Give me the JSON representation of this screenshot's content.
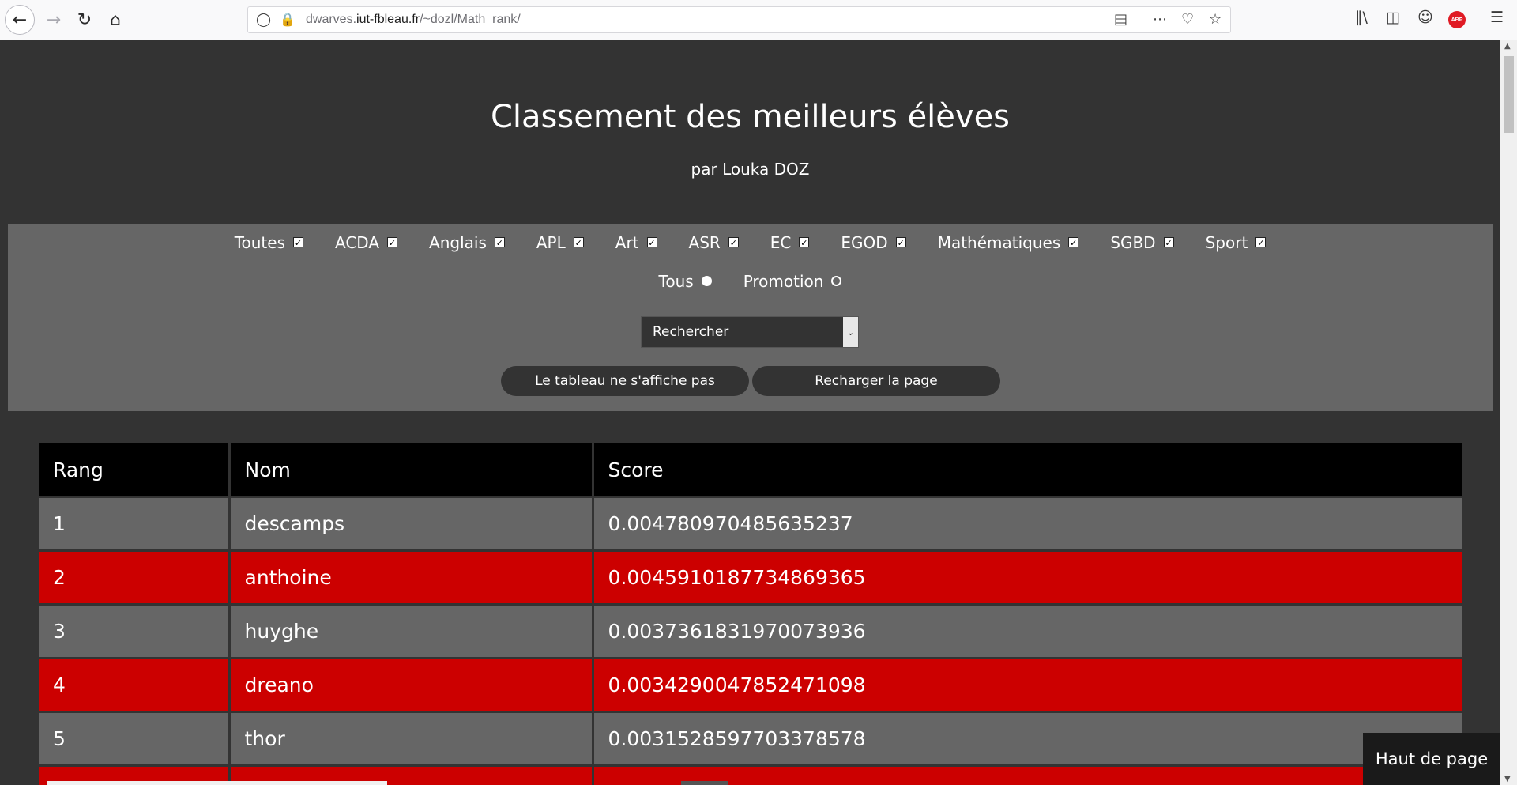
{
  "browser": {
    "url_host_prefix": "dwarves.",
    "url_host_domain": "iut-fbleau.fr",
    "url_path": "/~dozl/Math_rank/",
    "icons": [
      "back-arrow-icon",
      "forward-arrow-icon",
      "reload-icon",
      "home-icon",
      "shield-icon",
      "insecure-lock-icon",
      "reader-view-icon",
      "more-icon",
      "pocket-icon",
      "bookmark-star-icon",
      "library-icon",
      "sidebar-icon",
      "account-icon",
      "adblock-icon",
      "menu-icon"
    ]
  },
  "page": {
    "title": "Classement des meilleurs élèves",
    "subtitle": "par Louka DOZ",
    "subjects": [
      {
        "label": "Toutes",
        "checked": true
      },
      {
        "label": "ACDA",
        "checked": true
      },
      {
        "label": "Anglais",
        "checked": true
      },
      {
        "label": "APL",
        "checked": true
      },
      {
        "label": "Art",
        "checked": true
      },
      {
        "label": "ASR",
        "checked": true
      },
      {
        "label": "EC",
        "checked": true
      },
      {
        "label": "EGOD",
        "checked": true
      },
      {
        "label": "Mathématiques",
        "checked": true
      },
      {
        "label": "SGBD",
        "checked": true
      },
      {
        "label": "Sport",
        "checked": true
      }
    ],
    "scope": [
      {
        "label": "Tous",
        "checked": true
      },
      {
        "label": "Promotion",
        "checked": false
      }
    ],
    "search_select_value": "Rechercher",
    "buttons": {
      "table_missing": "Le tableau ne s'affiche pas",
      "reload": "Recharger la page"
    },
    "table": {
      "headers": [
        "Rang",
        "Nom",
        "Score"
      ],
      "rows": [
        [
          "1",
          "descamps",
          "0.004780970485635237"
        ],
        [
          "2",
          "anthoine",
          "0.0045910187734869365"
        ],
        [
          "3",
          "huyghe",
          "0.0037361831970073936"
        ],
        [
          "4",
          "dreano",
          "0.0034290047852471098"
        ],
        [
          "5",
          "thor",
          "0.0031528597703378578"
        ]
      ]
    },
    "back_to_top": "Haut de page",
    "colors": {
      "background": "#333333",
      "panel": "#666666",
      "accent_row": "#cc0000",
      "header": "#000000"
    }
  }
}
